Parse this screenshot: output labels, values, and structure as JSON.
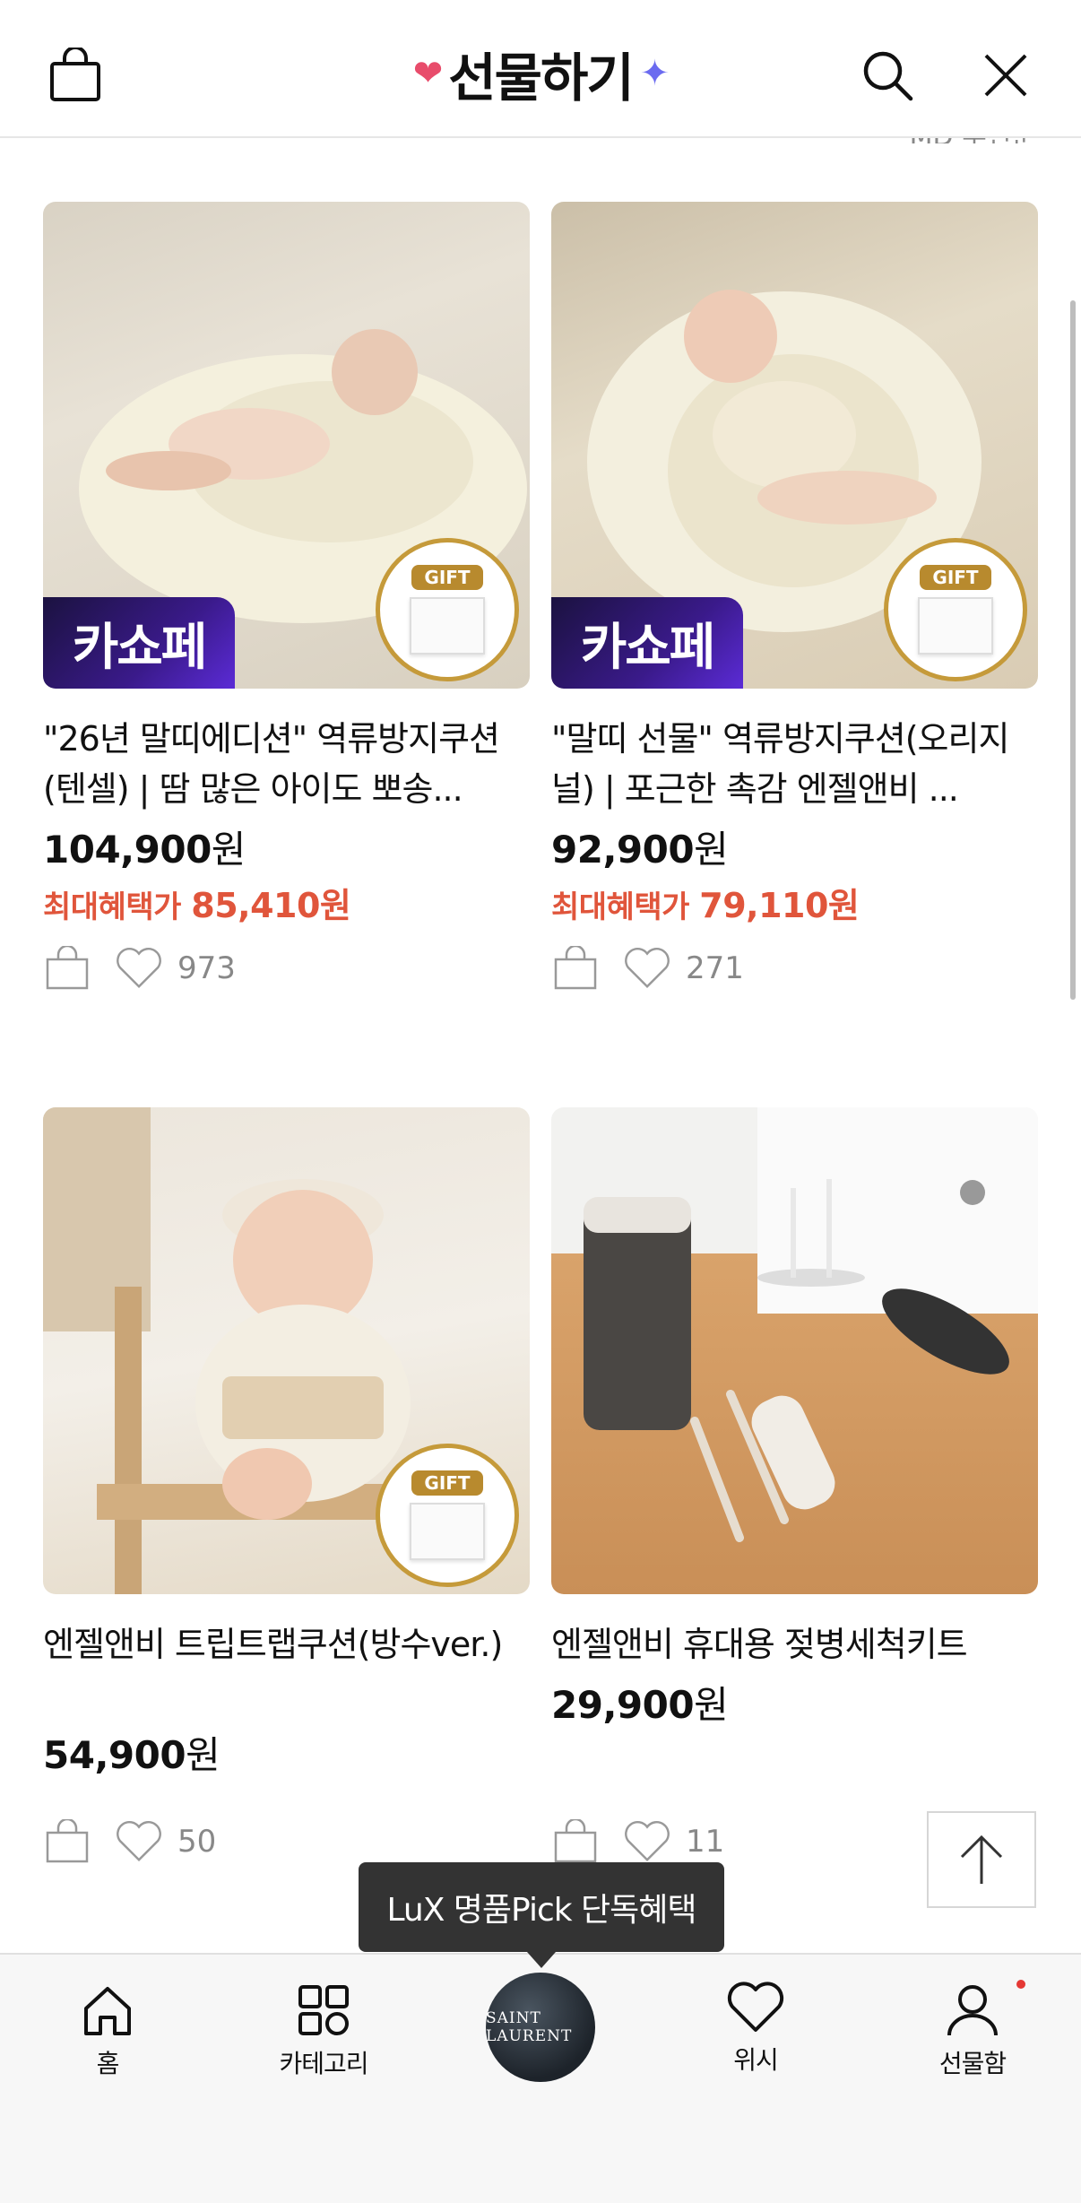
{
  "header": {
    "title": "선물하기",
    "deco_left": "❤",
    "deco_right": "✦",
    "sort_text": "MD 추천순"
  },
  "products": [
    {
      "badge": "카쇼페",
      "gift_tag": "GIFT",
      "name": "\"26년 말띠에디션\" 역류방지쿠션(텐셀) | 땀 많은 아이도 뽀송...",
      "price": "104,900",
      "won": "원",
      "benefit_label": "최대혜택가",
      "benefit_price": "85,410원",
      "likes": "973"
    },
    {
      "badge": "카쇼페",
      "gift_tag": "GIFT",
      "name": "\"말띠 선물\" 역류방지쿠션(오리지널) | 포근한 촉감 엔젤앤비 ...",
      "price": "92,900",
      "won": "원",
      "benefit_label": "최대혜택가",
      "benefit_price": "79,110원",
      "likes": "271"
    },
    {
      "gift_tag": "GIFT",
      "name": "엔젤앤비 트립트랩쿠션(방수ver.)",
      "price": "54,900",
      "won": "원",
      "likes": "50"
    },
    {
      "name": "엔젤앤비 휴대용 젖병세척키트",
      "price": "29,900",
      "won": "원",
      "likes": "11"
    }
  ],
  "tooltip": "LuX 명품Pick 단독혜택",
  "center_logo": "SAINT LAURENT",
  "bottom_nav": {
    "home": "홈",
    "category": "카테고리",
    "wish": "위시",
    "giftbox": "선물함"
  },
  "colors": {
    "benefit": "#e0553b",
    "badge": "#3a1a8a",
    "gift_gold": "#c59a3a"
  }
}
